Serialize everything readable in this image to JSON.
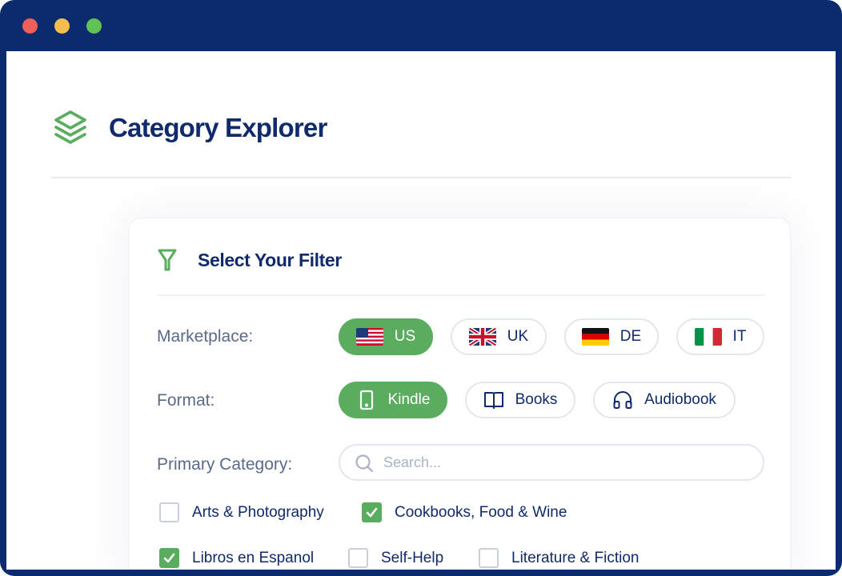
{
  "window": {
    "title": "Category Explorer"
  },
  "header": {
    "logo_icon": "layers-icon",
    "title": "Category Explorer"
  },
  "filter_card": {
    "title": "Select Your Filter",
    "icon": "filter-icon",
    "marketplace": {
      "label": "Marketplace:",
      "options": [
        {
          "label": "US",
          "flag": "us-flag-icon",
          "selected": true
        },
        {
          "label": "UK",
          "flag": "uk-flag-icon",
          "selected": false
        },
        {
          "label": "DE",
          "flag": "de-flag-icon",
          "selected": false
        },
        {
          "label": "IT",
          "flag": "it-flag-icon",
          "selected": false
        }
      ]
    },
    "format": {
      "label": "Format:",
      "options": [
        {
          "label": "Kindle",
          "icon": "tablet-icon",
          "selected": true
        },
        {
          "label": "Books",
          "icon": "book-icon",
          "selected": false
        },
        {
          "label": "Audiobook",
          "icon": "headphones-icon",
          "selected": false
        }
      ]
    },
    "primary_category": {
      "label": "Primary Category:",
      "search_placeholder": "Search...",
      "search_value": ""
    },
    "categories": [
      {
        "label": "Arts & Photography",
        "checked": false
      },
      {
        "label": "Cookbooks, Food & Wine",
        "checked": true
      },
      {
        "label": "Libros en Espanol",
        "checked": true
      },
      {
        "label": "Self-Help",
        "checked": false
      },
      {
        "label": "Literature & Fiction",
        "checked": false
      }
    ]
  },
  "colors": {
    "frame": "#0c2a6e",
    "accent": "#5aad5e",
    "text_primary": "#102a6b",
    "text_muted": "#5a6a89",
    "border": "#e3e7ee"
  }
}
